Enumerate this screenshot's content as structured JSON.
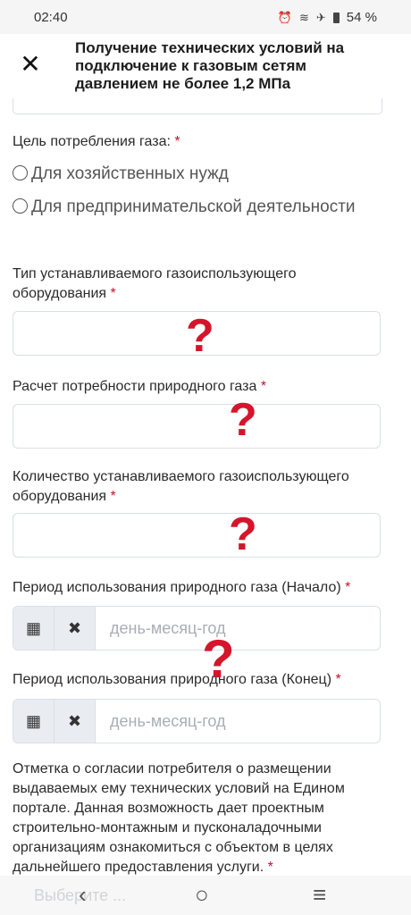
{
  "status_bar": {
    "time": "02:40",
    "icons": [
      "alarm-icon",
      "wifi-icon",
      "airplane-icon",
      "battery-icon"
    ],
    "battery": "54 %"
  },
  "header": {
    "close_glyph": "✕",
    "title": "Получение технических условий на подключение к газовым сетям давлением не более 1,2 МПа"
  },
  "form": {
    "purpose": {
      "label": "Цель потребления газа:",
      "required": "*",
      "options": [
        "Для хозяйственных нужд",
        "Для предпринимательской деятельности"
      ]
    },
    "equipment_type": {
      "label": "Тип устанавливаемого газоиспользующего оборудования",
      "required": "*"
    },
    "gas_demand": {
      "label": "Расчет потребности природного газа",
      "required": "*"
    },
    "equipment_count": {
      "label": "Количество устанавливаемого газоиспользующего оборудования",
      "required": "*"
    },
    "period_start": {
      "label": "Период использования природного газа (Начало)",
      "required": "*",
      "placeholder": "день-месяц-год"
    },
    "period_end": {
      "label": "Период использования природного газа (Конец)",
      "required": "*",
      "placeholder": "день-месяц-год"
    },
    "consent": {
      "text": "Отметка о согласии потребителя о размещении выдаваемых ему технических условий на Едином портале. Данная возможность дает проектным строительно-монтажным и пусконаладочными организациям ознакомиться с объектом в целях дальнейшего предоставления услуги.",
      "required": "*",
      "select_placeholder": "Выберите ..."
    }
  },
  "annotations": {
    "question_mark": "?"
  },
  "colors": {
    "required": "#c8102e",
    "question_mark": "#d4152b",
    "border": "#d9dfe7"
  },
  "nav": {
    "back": "‹",
    "home": "○",
    "recents": "≡"
  }
}
